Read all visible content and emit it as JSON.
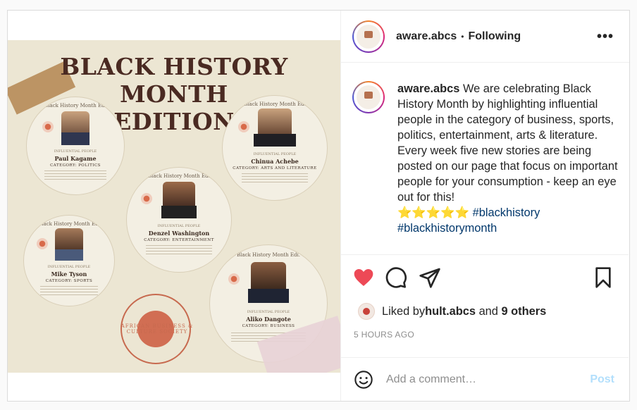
{
  "post": {
    "poster": {
      "title_line1": "BLACK HISTORY MONTH",
      "title_line2": "EDITION",
      "people": [
        {
          "label": "Black History Month Ed.",
          "tag": "INFLUENTIAL PEOPLE",
          "name": "Paul Kagame",
          "category": "CATEGORY: POLITICS"
        },
        {
          "label": "Black History Month Ed.",
          "tag": "INFLUENTIAL PEOPLE",
          "name": "Chinua Achebe",
          "category": "CATEGORY: ARTS AND LITERATURE"
        },
        {
          "label": "Black History Month Ed.",
          "tag": "INFLUENTIAL PEOPLE",
          "name": "Denzel Washington",
          "category": "CATEGORY: ENTERTAINMENT"
        },
        {
          "label": "Black History Month Ed.",
          "tag": "INFLUENTIAL PEOPLE",
          "name": "Mike Tyson",
          "category": "CATEGORY: SPORTS"
        },
        {
          "label": "Black History Month Edi.",
          "tag": "INFLUENTIAL PEOPLE",
          "name": "Aliko Dangote",
          "category": "CATEGORY: BUSINESS"
        }
      ],
      "seal_text": "AFRICAN BUSINESS & CULTURE SOCIETY"
    },
    "header": {
      "username": "aware.abcs",
      "separator": "•",
      "follow_status": "Following",
      "more_icon": "more-horizontal-icon"
    },
    "caption": {
      "username": "aware.abcs",
      "text": " We are celebrating Black History Month by highlighting influential people in the category of business, sports, politics, entertainment, arts & literature. Every week five new stories are being posted on our page that focus on important people for your consumption - keep an eye out for this! ",
      "stars": "⭐⭐⭐⭐⭐",
      "hashtag1": "#blackhistory",
      "hashtag2": "#blackhistorymonth"
    },
    "actions": {
      "like_icon": "heart-filled-icon",
      "comment_icon": "comment-icon",
      "share_icon": "share-icon",
      "save_icon": "bookmark-icon",
      "liked_prefix": "Liked by ",
      "liked_user": "hult.abcs",
      "liked_and": " and ",
      "liked_others": "9 others",
      "timestamp": "5 HOURS AGO"
    },
    "comment": {
      "emoji_icon": "smiley-icon",
      "placeholder": "Add a comment…",
      "post_label": "Post"
    },
    "colors": {
      "like": "#ed4956",
      "hashtag": "#00376b",
      "post_disabled": "#b2dffc",
      "poster_bg": "#ece6d3",
      "title_brown": "#4a2a22"
    }
  }
}
